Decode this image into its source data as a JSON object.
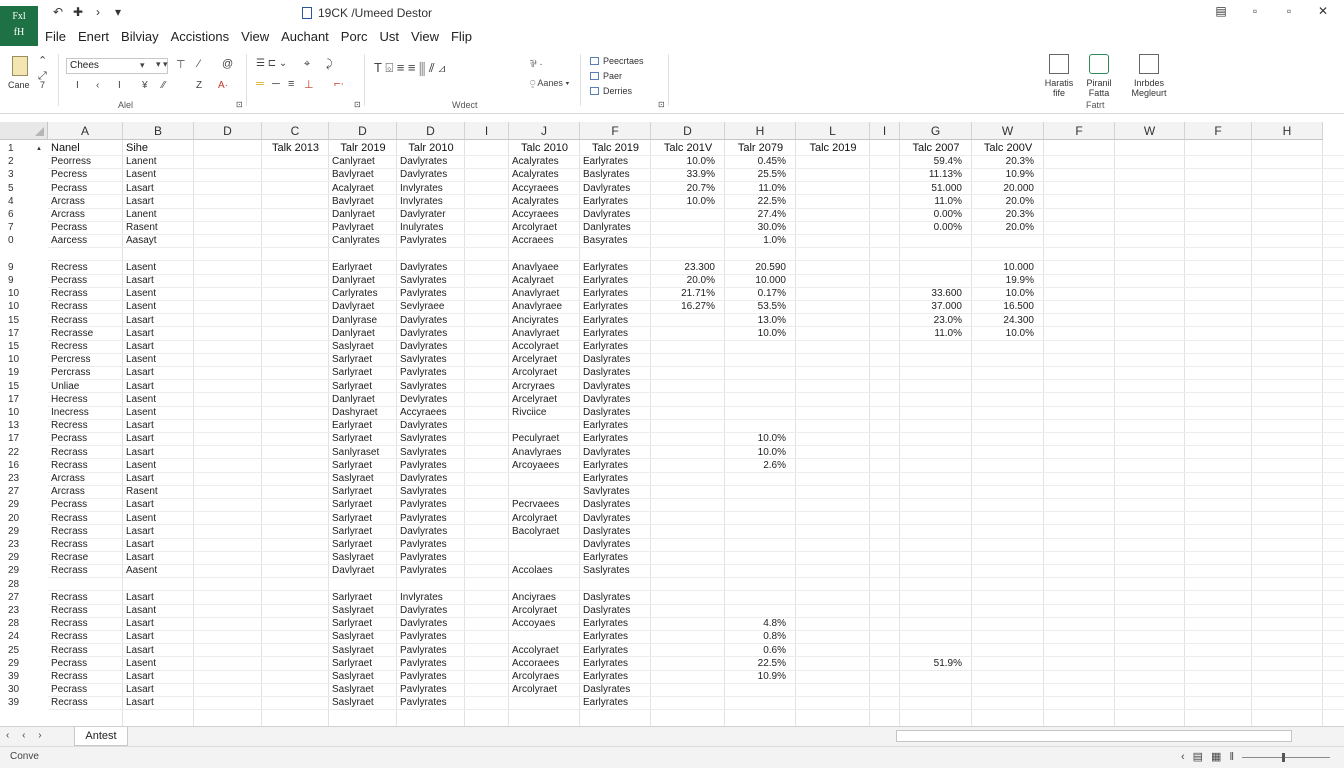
{
  "titlebar": {
    "app_badge_top": "Fxl",
    "app_badge_bottom": "fH",
    "doc_title": "19CK /Umeed Destor",
    "quick_access": [
      "↶",
      "✚",
      "›",
      "▾"
    ],
    "window_controls": [
      "▤",
      "▫",
      "▫",
      "✕"
    ]
  },
  "menu": [
    "File",
    "Enert",
    "Bilviay",
    "Accistions",
    "View",
    "Auchant",
    "Porc",
    "Ust",
    "View",
    "Flip"
  ],
  "ribbon": {
    "paste_label": "Cane",
    "paste_sub": "7",
    "font_name": "Chees",
    "group_labels": [
      "Alel",
      "Wdect",
      "Fatrt"
    ],
    "style_items": [
      "Peecrtaes",
      "Paer",
      "Derries"
    ],
    "wrap_label": "Aanes",
    "big_buttons": [
      {
        "icon": "file-icon",
        "label_1": "Haratis",
        "label_2": "fife"
      },
      {
        "icon": "drive-icon",
        "label_1": "Piranil",
        "label_2": "Fatta"
      },
      {
        "icon": "table-icon",
        "label_1": "Inrbdes",
        "label_2": "Megleurt"
      }
    ]
  },
  "columns": [
    {
      "key": "c0",
      "label": "A"
    },
    {
      "key": "c1",
      "label": "B"
    },
    {
      "key": "c2",
      "label": "D"
    },
    {
      "key": "c3",
      "label": "C"
    },
    {
      "key": "c4",
      "label": "D"
    },
    {
      "key": "c5",
      "label": "D"
    },
    {
      "key": "c6",
      "label": "I"
    },
    {
      "key": "c7",
      "label": "J"
    },
    {
      "key": "c8",
      "label": "F"
    },
    {
      "key": "c9",
      "label": "D"
    },
    {
      "key": "c10",
      "label": "H"
    },
    {
      "key": "c11",
      "label": "L"
    },
    {
      "key": "c12",
      "label": "I"
    },
    {
      "key": "c13",
      "label": "G"
    },
    {
      "key": "c14",
      "label": "W"
    },
    {
      "key": "c15",
      "label": "F"
    },
    {
      "key": "c16",
      "label": "W"
    },
    {
      "key": "c17",
      "label": "F"
    },
    {
      "key": "c18",
      "label": "H"
    }
  ],
  "row_numbers": [
    "1",
    "2",
    "3",
    "5",
    "4",
    "6",
    "7",
    "0",
    "",
    "9",
    "9",
    "10",
    "10",
    "15",
    "17",
    "15",
    "10",
    "19",
    "15",
    "17",
    "10",
    "13",
    "17",
    "22",
    "16",
    "23",
    "27",
    "29",
    "20",
    "29",
    "23",
    "29",
    "29",
    "28",
    "27",
    "23",
    "28",
    "24",
    "25",
    "29",
    "39",
    "30",
    "39"
  ],
  "table_header": {
    "c0": "Nanel",
    "c1": "Sihe",
    "c3": "Talk 2013",
    "c4": "Talr 2019",
    "c5": "Talr 2010",
    "c7": "Talc 2010",
    "c8": "Talc 2019",
    "c9": "Talc 201V",
    "c10": "Talr 2079",
    "c11": "Talc 2019",
    "c13": "Talc 2007",
    "c14": "Talc 200V"
  },
  "rows": [
    {
      "c0": "Peorress",
      "c1": "Lanent",
      "c4": "Canlyraet",
      "c5": "Davlyrates",
      "c7": "Acalyrates",
      "c8": "Earlyrates",
      "c9": "10.0%",
      "c10": "0.45%",
      "c13": "59.4%",
      "c14": "20.3%"
    },
    {
      "c0": "Pecress",
      "c1": "Lasent",
      "c4": "Bavlyraet",
      "c5": "Davlyrates",
      "c7": "Acalyrates",
      "c8": "Baslyrates",
      "c9": "33.9%",
      "c10": "25.5%",
      "c13": "11.13%",
      "c14": "10.9%"
    },
    {
      "c0": "Pecrass",
      "c1": "Lasart",
      "c4": "Acalyraet",
      "c5": "Invlyrates",
      "c7": "Accyraees",
      "c8": "Davlyrates",
      "c9": "20.7%",
      "c10": "11.0%",
      "c13": "51.000",
      "c14": "20.000"
    },
    {
      "c0": "Arcrass",
      "c1": "Lasart",
      "c4": "Bavlyraet",
      "c5": "Invlyrates",
      "c7": "Acalyrates",
      "c8": "Earlyrates",
      "c9": "10.0%",
      "c10": "22.5%",
      "c13": "11.0%",
      "c14": "20.0%"
    },
    {
      "c0": "Arcrass",
      "c1": "Lanent",
      "c4": "Danlyraet",
      "c5": "Davlyrater",
      "c7": "Accyraees",
      "c8": "Davlyrates",
      "c10": "27.4%",
      "c13": "0.00%",
      "c14": "20.3%"
    },
    {
      "c0": "Pecrass",
      "c1": "Rasent",
      "c4": "Pavlyraet",
      "c5": "Inulyrates",
      "c7": "Arcolyraet",
      "c8": "Danlyrates",
      "c10": "30.0%",
      "c13": "0.00%",
      "c14": "20.0%"
    },
    {
      "c0": "Aarcess",
      "c1": "Aasayt",
      "c4": "Canlyrates",
      "c5": "Pavlyrates",
      "c7": "Accraees",
      "c8": "Basyrates",
      "c10": "1.0%"
    },
    {},
    {
      "c0": "Recress",
      "c1": "Lasent",
      "c4": "Earlyraet",
      "c5": "Davlyrates",
      "c7": "Anavlyaee",
      "c8": "Earlyrates",
      "c9": "23.300",
      "c10": "20.590",
      "c14": "10.000"
    },
    {
      "c0": "Pecrass",
      "c1": "Lasart",
      "c4": "Danlyraet",
      "c5": "Savlyrates",
      "c7": "Acalyraet",
      "c8": "Earlyrates",
      "c9": "20.0%",
      "c10": "10.000",
      "c14": "19.9%"
    },
    {
      "c0": "Recrass",
      "c1": "Lasent",
      "c4": "Carlyrates",
      "c5": "Pavlyrates",
      "c7": "Anavlyraet",
      "c8": "Earlyrates",
      "c9": "21.71%",
      "c10": "0.17%",
      "c13": "33.600",
      "c14": "10.0%"
    },
    {
      "c0": "Recrass",
      "c1": "Lasent",
      "c4": "Davlyraet",
      "c5": "Sevlyraee",
      "c7": "Anavlyraee",
      "c8": "Earlyrates",
      "c9": "16.27%",
      "c10": "53.5%",
      "c13": "37.000",
      "c14": "16.500"
    },
    {
      "c0": "Recrass",
      "c1": "Lasart",
      "c4": "Danlyrase",
      "c5": "Davlyrates",
      "c7": "Anciyrates",
      "c8": "Earlyrates",
      "c10": "13.0%",
      "c13": "23.0%",
      "c14": "24.300"
    },
    {
      "c0": "Recrasse",
      "c1": "Lasart",
      "c4": "Danlyraet",
      "c5": "Davlyrates",
      "c7": "Anavlyraet",
      "c8": "Earlyrates",
      "c10": "10.0%",
      "c13": "11.0%",
      "c14": "10.0%"
    },
    {
      "c0": "Recress",
      "c1": "Lasart",
      "c4": "Saslyraet",
      "c5": "Davlyrates",
      "c7": "Accolyraet",
      "c8": "Earlyrates"
    },
    {
      "c0": "Percress",
      "c1": "Lasent",
      "c4": "Sarlyraet",
      "c5": "Savlyrates",
      "c7": "Arcelyraet",
      "c8": "Daslyrates"
    },
    {
      "c0": "Percrass",
      "c1": "Lasart",
      "c4": "Sarlyraet",
      "c5": "Pavlyrates",
      "c7": "Arcolyraet",
      "c8": "Daslyrates"
    },
    {
      "c0": "Unliae",
      "c1": "Lasart",
      "c4": "Sarlyraet",
      "c5": "Savlyrates",
      "c7": "Arcryraes",
      "c8": "Davlyrates"
    },
    {
      "c0": "Hecress",
      "c1": "Lasent",
      "c4": "Danlyraet",
      "c5": "Devlyrates",
      "c7": "Arcelyraet",
      "c8": "Davlyrates"
    },
    {
      "c0": "Inecress",
      "c1": "Lasent",
      "c4": "Dashyraet",
      "c5": "Accyraees",
      "c7": "Rivciice",
      "c8": "Daslyrates"
    },
    {
      "c0": "Recress",
      "c1": "Lasart",
      "c4": "Earlyraet",
      "c5": "Davlyrates",
      "c8": "Earlyrates"
    },
    {
      "c0": "Pecrass",
      "c1": "Lasart",
      "c4": "Sarlyraet",
      "c5": "Savlyrates",
      "c7": "Peculyraet",
      "c8": "Earlyrates",
      "c10": "10.0%"
    },
    {
      "c0": "Recrass",
      "c1": "Lasart",
      "c4": "Sanlyraset",
      "c5": "Savlyrates",
      "c7": "Anavlyraes",
      "c8": "Davlyrates",
      "c10": "10.0%"
    },
    {
      "c0": "Recrass",
      "c1": "Lasent",
      "c4": "Sarlyraet",
      "c5": "Pavlyrates",
      "c7": "Arcoyaees",
      "c8": "Earlyrates",
      "c10": "2.6%"
    },
    {
      "c0": "Arcrass",
      "c1": "Lasart",
      "c4": "Saslyraet",
      "c5": "Davlyrates",
      "c8": "Earlyrates"
    },
    {
      "c0": "Arcrass",
      "c1": "Rasent",
      "c4": "Sarlyraet",
      "c5": "Savlyrates",
      "c8": "Savlyrates"
    },
    {
      "c0": "Pecrass",
      "c1": "Lasart",
      "c4": "Sarlyraet",
      "c5": "Pavlyrates",
      "c7": "Pecrvaees",
      "c8": "Daslyrates"
    },
    {
      "c0": "Recrass",
      "c1": "Lasent",
      "c4": "Sarlyraet",
      "c5": "Pavlyrates",
      "c7": "Arcolyraet",
      "c8": "Davlyrates"
    },
    {
      "c0": "Recrass",
      "c1": "Lasart",
      "c4": "Sarlyraet",
      "c5": "Davlyrates",
      "c7": "Bacolyraet",
      "c8": "Daslyrates"
    },
    {
      "c0": "Recrass",
      "c1": "Lasart",
      "c4": "Sarlyraet",
      "c5": "Pavlyrates",
      "c8": "Davlyrates"
    },
    {
      "c0": "Recrase",
      "c1": "Lasart",
      "c4": "Saslyraet",
      "c5": "Pavlyrates",
      "c8": "Earlyrates"
    },
    {
      "c0": "Recrass",
      "c1": "Aasent",
      "c4": "Davlyraet",
      "c5": "Pavlyrates",
      "c7": "Accolaes",
      "c8": "Saslyrates"
    },
    {},
    {
      "c0": "Recrass",
      "c1": "Lasart",
      "c4": "Sarlyraet",
      "c5": "Invlyrates",
      "c7": "Anciyraes",
      "c8": "Daslyrates"
    },
    {
      "c0": "Recrass",
      "c1": "Lasant",
      "c4": "Saslyraet",
      "c5": "Davlyrates",
      "c7": "Arcolyraet",
      "c8": "Daslyrates"
    },
    {
      "c0": "Recrass",
      "c1": "Lasart",
      "c4": "Sarlyraet",
      "c5": "Davlyrates",
      "c7": "Accoyaes",
      "c8": "Earlyrates",
      "c10": "4.8%"
    },
    {
      "c0": "Recrass",
      "c1": "Lasart",
      "c4": "Saslyraet",
      "c5": "Pavlyrates",
      "c8": "Earlyrates",
      "c10": "0.8%"
    },
    {
      "c0": "Recrass",
      "c1": "Lasart",
      "c4": "Saslyraet",
      "c5": "Pavlyrates",
      "c7": "Accolyraet",
      "c8": "Earlyrates",
      "c10": "0.6%"
    },
    {
      "c0": "Pecrass",
      "c1": "Lasent",
      "c4": "Sarlyraet",
      "c5": "Pavlyrates",
      "c7": "Accoraees",
      "c8": "Earlyrates",
      "c10": "22.5%",
      "c13": "51.9%"
    },
    {
      "c0": "Recrass",
      "c1": "Lasart",
      "c4": "Saslyraet",
      "c5": "Pavlyrates",
      "c7": "Arcolyraes",
      "c8": "Earlyrates",
      "c10": "10.9%"
    },
    {
      "c0": "Pecrass",
      "c1": "Lasart",
      "c4": "Saslyraet",
      "c5": "Pavlyrates",
      "c7": "Arcolyraet",
      "c8": "Daslyrates"
    },
    {
      "c0": "Recrass",
      "c1": "Lasart",
      "c4": "Saslyraet",
      "c5": "Pavlyrates",
      "c8": "Earlyrates"
    }
  ],
  "sheet_tab": "Antest",
  "sheet_nav": "‹ ‹ ›",
  "status": "Conve",
  "status_icons": [
    "‹",
    "▤",
    "▦",
    "‖"
  ]
}
